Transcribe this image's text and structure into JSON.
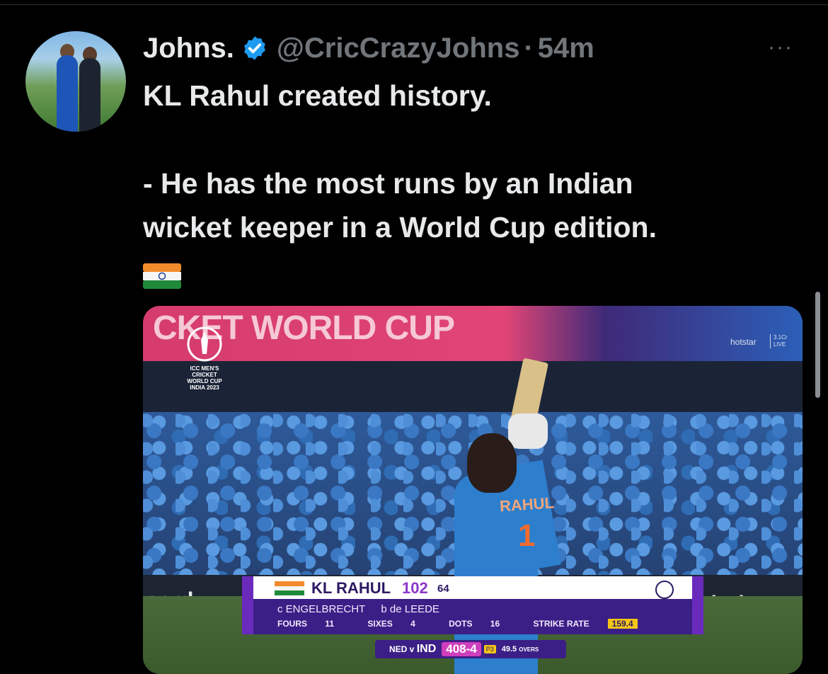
{
  "tweet": {
    "author_name": "Johns.",
    "handle": "@CricCrazyJohns",
    "separator": "·",
    "time": "54m",
    "more": "···",
    "lines": [
      "KL Rahul created history.",
      "",
      "- He has the most runs by an Indian",
      "wicket keeper in a World Cup edition."
    ],
    "emoji": "india-flag"
  },
  "media": {
    "banner_text": "CKET WORLD CUP",
    "logo_text": [
      "ICC MEN'S",
      "CRICKET",
      "WORLD CUP",
      "INDIA 2023"
    ],
    "broadcaster": "hotstar",
    "live_views": "3.1Cr",
    "live_label": "LIVE",
    "ad_left": "card",
    "ad_right": "riceless",
    "jersey_name": "RAHUL",
    "jersey_number": "1",
    "scorecard": {
      "batter": "KL RAHUL",
      "runs": "102",
      "balls": "64",
      "caught": "c ENGELBRECHT",
      "bowled": "b de LEEDE",
      "fours_label": "FOURS",
      "fours": "11",
      "sixes_label": "SIXES",
      "sixes": "4",
      "dots_label": "DOTS",
      "dots": "16",
      "sr_label": "STRIKE RATE",
      "sr": "159.4"
    },
    "match": {
      "teams": "NED v",
      "batting": "IND",
      "total": "408-4",
      "phase": "P3",
      "overs": "49.5",
      "overs_label": "OVERS"
    }
  }
}
